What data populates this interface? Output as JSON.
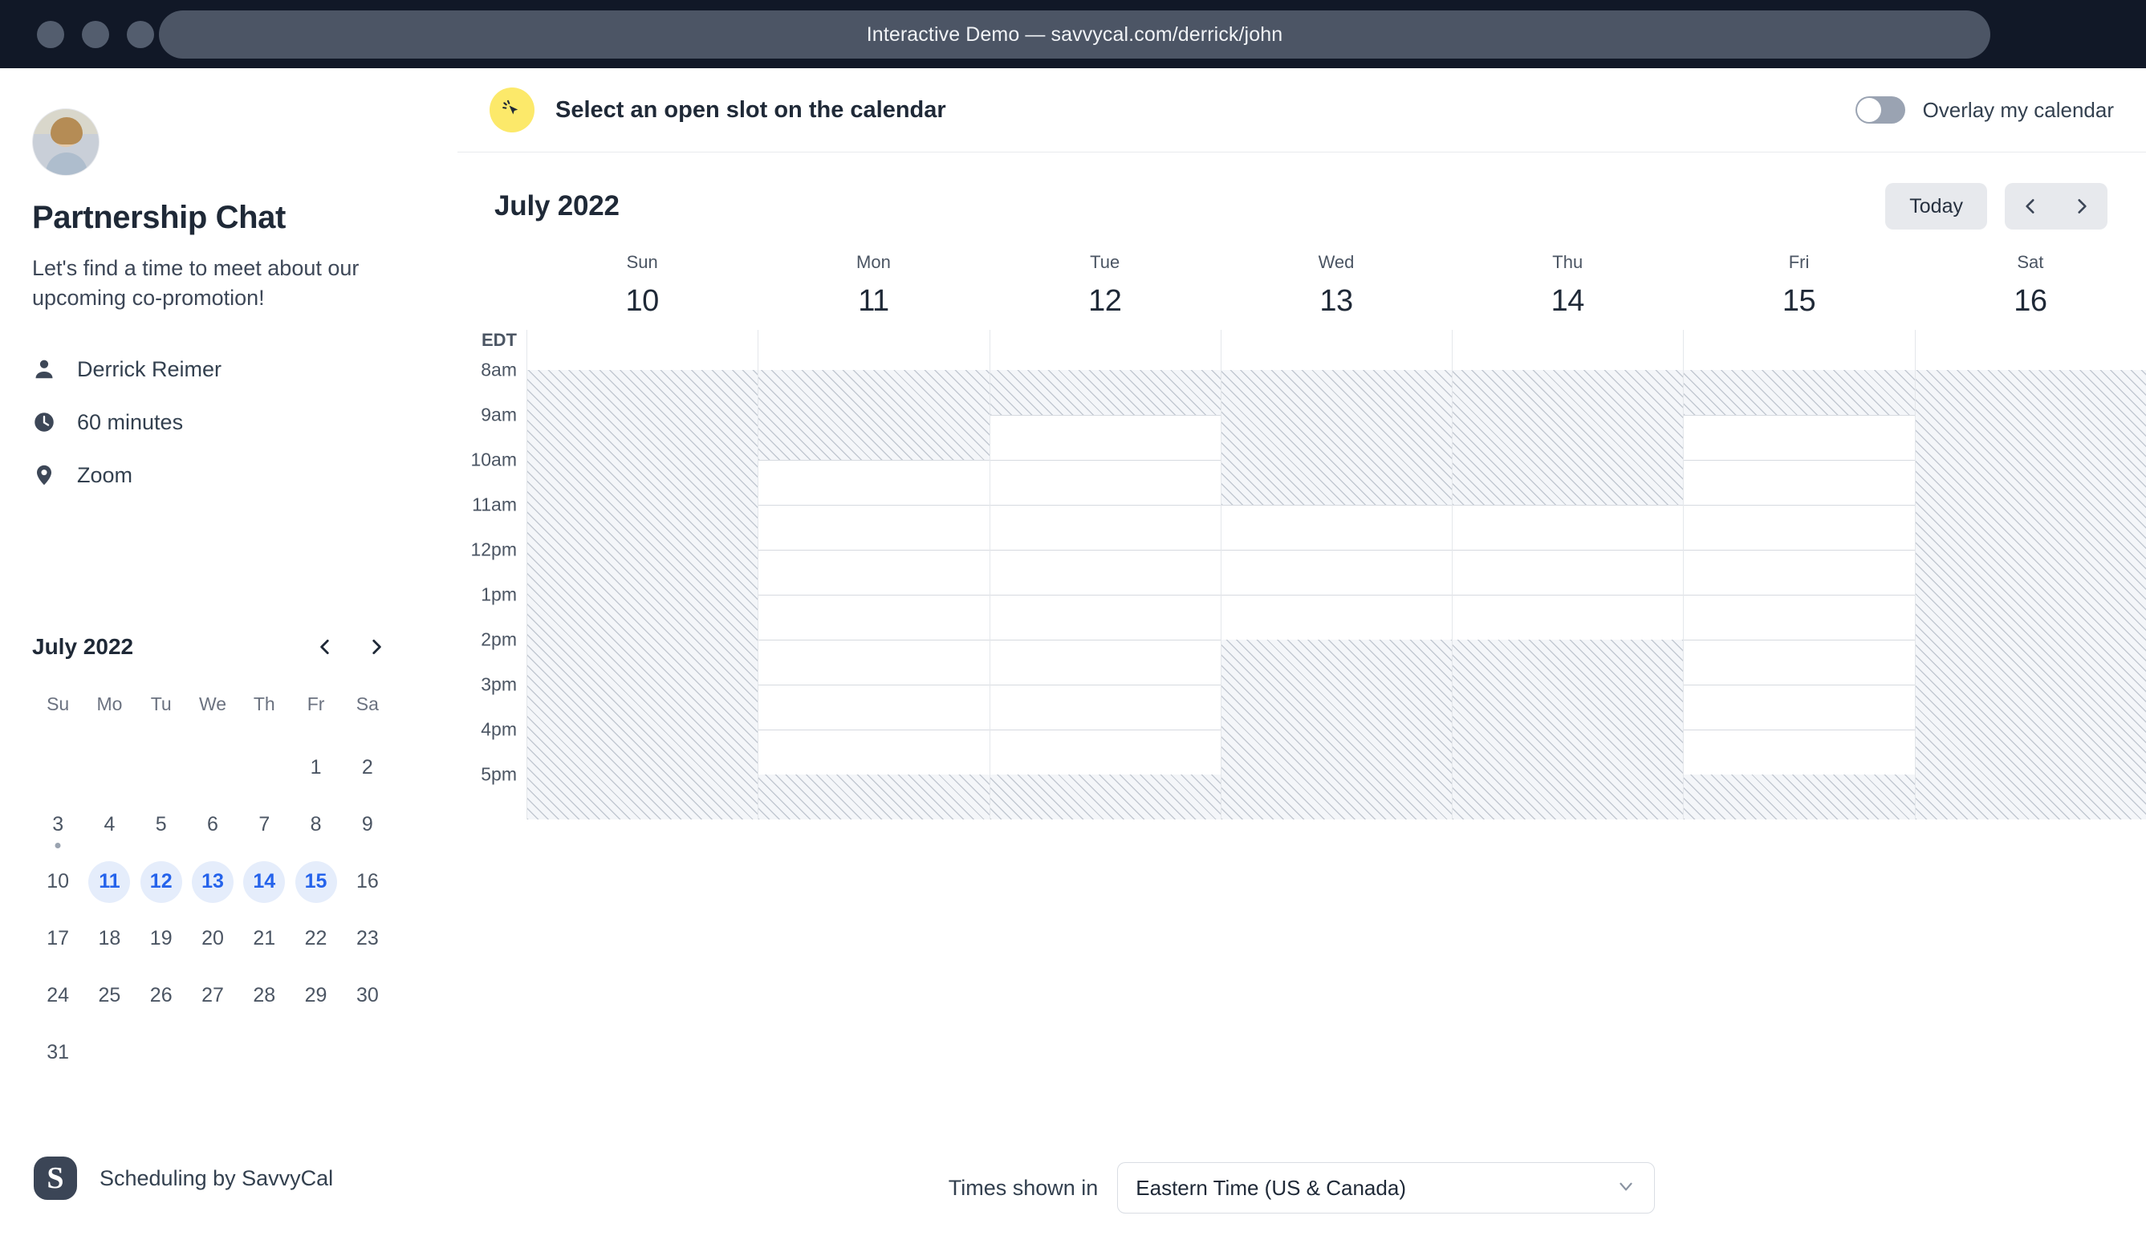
{
  "window": {
    "title": "Interactive Demo — savvycal.com/derrick/john",
    "traffic_lights": [
      "close",
      "minimize",
      "zoom"
    ]
  },
  "sidebar": {
    "avatar_alt": "avatar",
    "title": "Partnership Chat",
    "description": "Let's find a time to meet about our upcoming co-promotion!",
    "meta": [
      {
        "icon": "person-icon",
        "label": "Derrick Reimer"
      },
      {
        "icon": "clock-icon",
        "label": "60 minutes"
      },
      {
        "icon": "location-pin-icon",
        "label": "Zoom"
      }
    ],
    "mini_calendar": {
      "title": "July 2022",
      "prev_label": "Previous month",
      "next_label": "Next month",
      "dow": [
        "Su",
        "Mo",
        "Tu",
        "We",
        "Th",
        "Fr",
        "Sa"
      ],
      "leading_blanks": 5,
      "days": [
        {
          "n": "1"
        },
        {
          "n": "2"
        },
        {
          "n": "3",
          "dot": true
        },
        {
          "n": "4"
        },
        {
          "n": "5"
        },
        {
          "n": "6"
        },
        {
          "n": "7"
        },
        {
          "n": "8"
        },
        {
          "n": "9"
        },
        {
          "n": "10"
        },
        {
          "n": "11",
          "selected": true
        },
        {
          "n": "12",
          "selected": true
        },
        {
          "n": "13",
          "selected": true
        },
        {
          "n": "14",
          "selected": true
        },
        {
          "n": "15",
          "selected": true
        },
        {
          "n": "16"
        },
        {
          "n": "17"
        },
        {
          "n": "18"
        },
        {
          "n": "19"
        },
        {
          "n": "20"
        },
        {
          "n": "21"
        },
        {
          "n": "22"
        },
        {
          "n": "23"
        },
        {
          "n": "24"
        },
        {
          "n": "25"
        },
        {
          "n": "26"
        },
        {
          "n": "27"
        },
        {
          "n": "28"
        },
        {
          "n": "29"
        },
        {
          "n": "30"
        },
        {
          "n": "31"
        }
      ],
      "selected_color": "#2563eb",
      "selected_bg": "#e5edfb"
    },
    "brand": {
      "mark": "S",
      "text": "Scheduling by SavvyCal"
    }
  },
  "main": {
    "prompt": {
      "icon": "click-cursor-icon",
      "text": "Select an open slot on the calendar",
      "badge_color": "#fce96a"
    },
    "overlay_toggle": {
      "label": "Overlay my calendar",
      "checked": false
    },
    "calendar": {
      "month_title": "July 2022",
      "today_label": "Today",
      "prev_label": "Previous week",
      "next_label": "Next week",
      "timezone_abbr": "EDT",
      "days": [
        {
          "name": "Sun",
          "num": "10"
        },
        {
          "name": "Mon",
          "num": "11"
        },
        {
          "name": "Tue",
          "num": "12"
        },
        {
          "name": "Wed",
          "num": "13"
        },
        {
          "name": "Thu",
          "num": "14"
        },
        {
          "name": "Fri",
          "num": "15"
        },
        {
          "name": "Sat",
          "num": "16"
        }
      ],
      "time_labels": [
        "8am",
        "9am",
        "10am",
        "11am",
        "12pm",
        "1pm",
        "2pm",
        "3pm",
        "4pm",
        "5pm"
      ],
      "hour_start": 8,
      "hour_end": 18,
      "busy_blocks": [
        {
          "day": 0,
          "start": 8,
          "end": 18
        },
        {
          "day": 1,
          "start": 8,
          "end": 10
        },
        {
          "day": 1,
          "start": 17,
          "end": 18
        },
        {
          "day": 2,
          "start": 8,
          "end": 9
        },
        {
          "day": 2,
          "start": 17,
          "end": 18
        },
        {
          "day": 3,
          "start": 8,
          "end": 11
        },
        {
          "day": 3,
          "start": 14,
          "end": 18
        },
        {
          "day": 4,
          "start": 8,
          "end": 11
        },
        {
          "day": 4,
          "start": 14,
          "end": 18
        },
        {
          "day": 5,
          "start": 8,
          "end": 9
        },
        {
          "day": 5,
          "start": 17,
          "end": 18
        },
        {
          "day": 6,
          "start": 8,
          "end": 18
        }
      ]
    },
    "footer": {
      "label": "Times shown in",
      "timezone_value": "Eastern Time (US & Canada)"
    }
  }
}
